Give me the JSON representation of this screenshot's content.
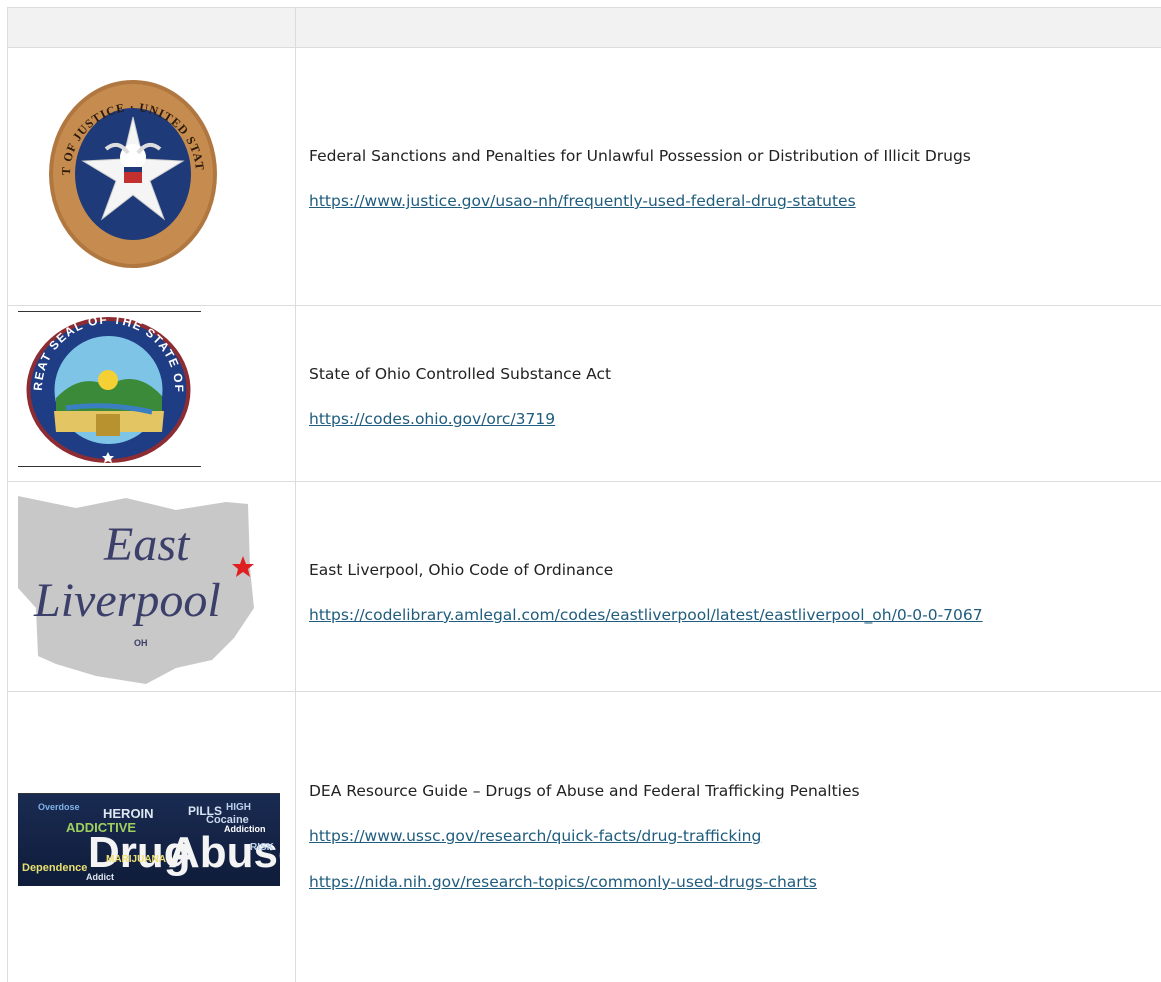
{
  "rows": [
    {
      "title": "Federal Sanctions and Penalties for Unlawful Possession or Distribution of Illicit Drugs",
      "links": [
        "https://www.justice.gov/usao-nh/frequently-used-federal-drug-statutes"
      ],
      "image": {
        "kind": "seal-icon",
        "text": "DEPARTMENT OF JUSTICE · UNITED STATES MARSHAL"
      }
    },
    {
      "title": "State of Ohio Controlled Substance Act",
      "links": [
        "https://codes.ohio.gov/orc/3719"
      ],
      "image": {
        "kind": "seal-icon",
        "text": "THE GREAT SEAL OF THE STATE OF OHIO"
      }
    },
    {
      "title": "East Liverpool, Ohio Code of Ordinance",
      "links": [
        "https://codelibrary.amlegal.com/codes/eastliverpool/latest/eastliverpool_oh/0-0-0-7067"
      ],
      "image": {
        "kind": "ohio-map-icon",
        "text_line1": "East",
        "text_line2": "Liverpool",
        "state": "OH"
      }
    },
    {
      "title": "DEA Resource Guide – Drugs of Abuse and Federal Trafficking Penalties",
      "links": [
        "https://www.ussc.gov/research/quick-facts/drug-trafficking",
        "https://nida.nih.gov/research-topics/commonly-used-drugs-charts"
      ],
      "image": {
        "kind": "word-cloud-icon",
        "words": [
          "Drug",
          "Abuse",
          "HEROIN",
          "ADDICTIVE",
          "PILLS",
          "Cocaine",
          "Overdose",
          "MARIJUANA",
          "Addiction",
          "Dependence",
          "Addict",
          "HIGH",
          "RISK"
        ]
      }
    }
  ]
}
